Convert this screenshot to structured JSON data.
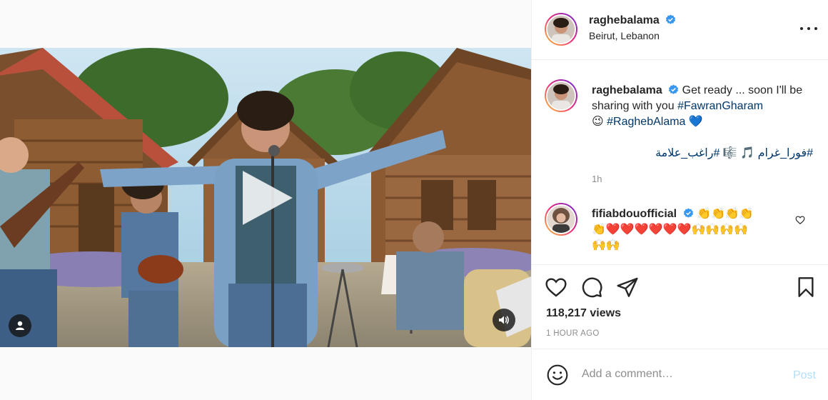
{
  "post": {
    "username": "raghebalama",
    "location": "Beirut, Lebanon",
    "views": "118,217 views",
    "time_ago": "1 HOUR AGO"
  },
  "caption": {
    "username": "raghebalama",
    "text_1": "Get ready ... soon I'll be sharing with you",
    "hashtag_1": "#FawranGharam",
    "emoji_1": "😉",
    "hashtag_2": "#RaghebAlama",
    "emoji_2": "💙",
    "arabic_tag_1": "#فورا_غرام",
    "arabic_emoji": "🎵",
    "arabic_emoji_2": "🎼",
    "arabic_tag_2": "#راغب_علامة",
    "time": "1h"
  },
  "comments": [
    {
      "username": "fifiabdouofficial",
      "line_1": "👏👏👏👏",
      "line_2": "👏❤️❤️❤️❤️❤️❤️🙌🙌🙌🙌",
      "line_3": "🙌🙌"
    }
  ],
  "add_comment": {
    "placeholder": "Add a comment…",
    "post_label": "Post"
  },
  "icons": {
    "verified": "verified-badge-icon",
    "like": "heart-icon",
    "comment": "comment-bubble-icon",
    "share": "paper-plane-icon",
    "save": "bookmark-icon",
    "emoji": "smiley-icon",
    "more": "ellipsis-icon",
    "play": "play-icon",
    "mute": "speaker-icon",
    "tagged": "user-tag-icon"
  },
  "colors": {
    "verified": "#3897f0",
    "hashtag": "#00376b",
    "muted_text": "#8e8e8e",
    "post_disabled": "#b2dffc"
  }
}
